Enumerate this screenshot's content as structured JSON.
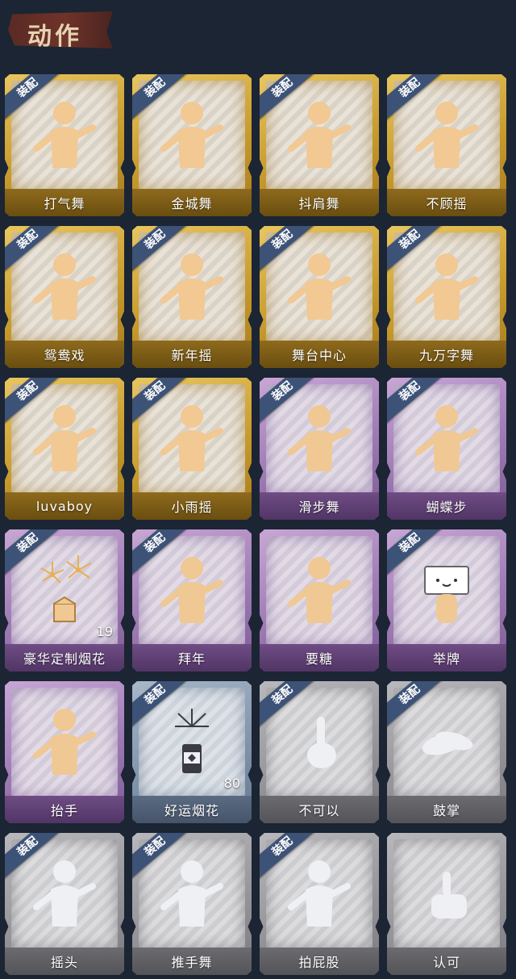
{
  "header": {
    "title": "动作"
  },
  "colors": {
    "gold_skin": "#f2c893",
    "purple_skin": "#f0c894",
    "gray_skin": "#eef0f4"
  },
  "cards": [
    {
      "label": "打气舞",
      "tier": "gold",
      "equipped": true,
      "icon": "dance-figure-icon"
    },
    {
      "label": "金城舞",
      "tier": "gold",
      "equipped": true,
      "icon": "dance-figure-icon"
    },
    {
      "label": "抖肩舞",
      "tier": "gold",
      "equipped": true,
      "icon": "dance-figure-icon"
    },
    {
      "label": "不顾摇",
      "tier": "gold",
      "equipped": true,
      "icon": "dance-figure-icon"
    },
    {
      "label": "鸳鸯戏",
      "tier": "gold",
      "equipped": true,
      "icon": "dance-figure-icon"
    },
    {
      "label": "新年摇",
      "tier": "gold",
      "equipped": true,
      "icon": "dance-figure-icon"
    },
    {
      "label": "舞台中心",
      "tier": "gold",
      "equipped": true,
      "icon": "dance-figure-icon"
    },
    {
      "label": "九万字舞",
      "tier": "gold",
      "equipped": true,
      "icon": "dance-figure-icon"
    },
    {
      "label": "luvaboy",
      "tier": "gold",
      "equipped": true,
      "icon": "dance-figure-icon"
    },
    {
      "label": "小雨摇",
      "tier": "gold",
      "equipped": true,
      "icon": "dance-figure-icon"
    },
    {
      "label": "滑步舞",
      "tier": "purple",
      "equipped": true,
      "icon": "dance-figure-icon"
    },
    {
      "label": "蝴蝶步",
      "tier": "purple",
      "equipped": true,
      "icon": "dance-figure-icon"
    },
    {
      "label": "豪华定制烟花",
      "tier": "purple",
      "equipped": true,
      "icon": "fireworks-box-icon",
      "count": "19"
    },
    {
      "label": "拜年",
      "tier": "purple",
      "equipped": true,
      "icon": "greeting-figure-icon"
    },
    {
      "label": "要糖",
      "tier": "purple",
      "equipped": false,
      "icon": "greeting-figure-icon"
    },
    {
      "label": "举牌",
      "tier": "purple",
      "equipped": true,
      "icon": "sign-figure-icon"
    },
    {
      "label": "抬手",
      "tier": "purple",
      "equipped": false,
      "icon": "raise-hand-figure-icon"
    },
    {
      "label": "好运烟花",
      "tier": "blue",
      "equipped": true,
      "icon": "firework-can-icon",
      "count": "80"
    },
    {
      "label": "不可以",
      "tier": "gray",
      "equipped": true,
      "icon": "finger-wag-icon"
    },
    {
      "label": "鼓掌",
      "tier": "gray",
      "equipped": true,
      "icon": "clap-hands-icon"
    },
    {
      "label": "摇头",
      "tier": "gray",
      "equipped": true,
      "icon": "dance-figure-icon"
    },
    {
      "label": "推手舞",
      "tier": "gray",
      "equipped": true,
      "icon": "dance-figure-icon"
    },
    {
      "label": "拍屁股",
      "tier": "gray",
      "equipped": true,
      "icon": "dance-figure-icon"
    },
    {
      "label": "认可",
      "tier": "gray",
      "equipped": false,
      "icon": "thumbs-up-icon"
    }
  ],
  "equipped_badge": "装配"
}
